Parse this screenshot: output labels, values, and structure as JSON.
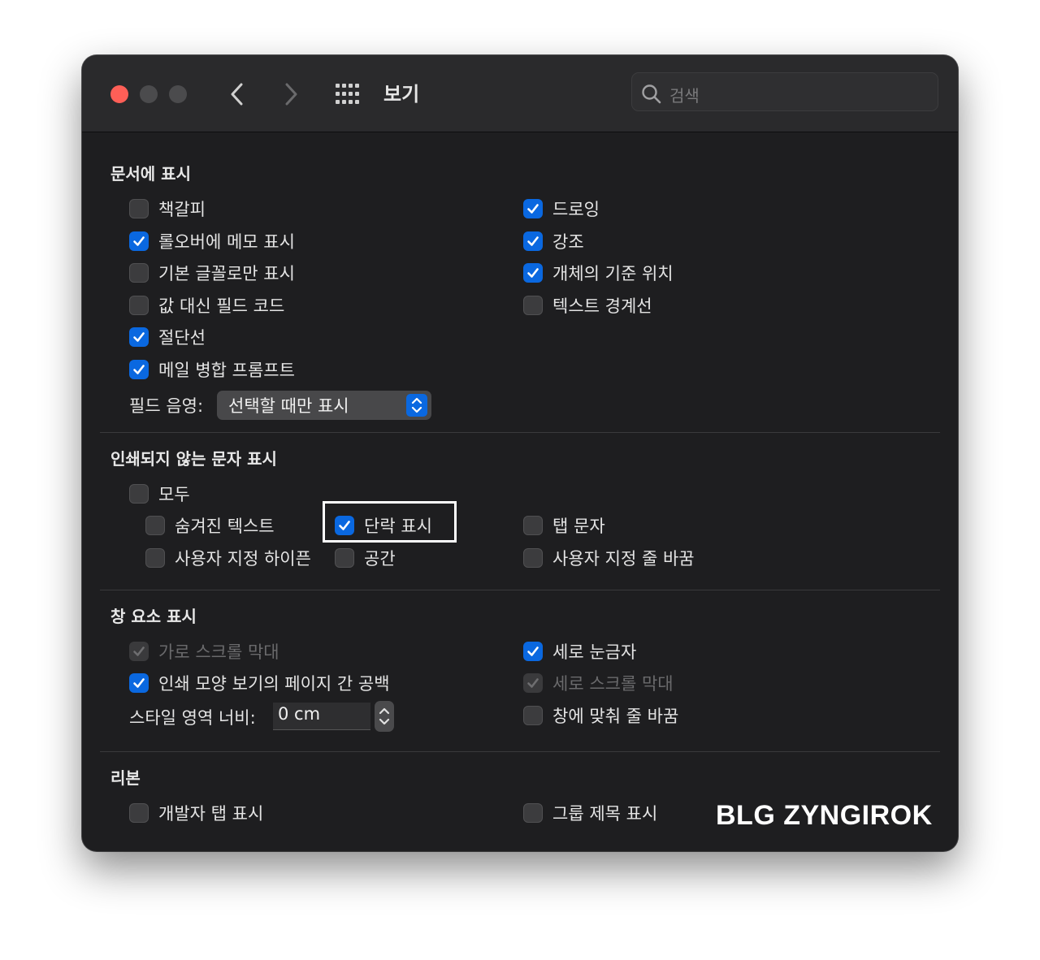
{
  "window": {
    "title": "보기",
    "search": {
      "placeholder": "검색"
    }
  },
  "sections": {
    "show_in_document": {
      "title": "문서에 표시",
      "items": [
        {
          "label": "책갈피",
          "checked": false
        },
        {
          "label": "롤오버에 메모 표시",
          "checked": true
        },
        {
          "label": "기본 글꼴로만 표시",
          "checked": false
        },
        {
          "label": "값 대신 필드 코드",
          "checked": false
        },
        {
          "label": "절단선",
          "checked": true
        },
        {
          "label": "메일 병합 프롬프트",
          "checked": true
        },
        {
          "label": "드로잉",
          "checked": true
        },
        {
          "label": "강조",
          "checked": true
        },
        {
          "label": "개체의 기준 위치",
          "checked": true
        },
        {
          "label": "텍스트 경계선",
          "checked": false
        }
      ],
      "field_shading": {
        "label": "필드 음영:",
        "value": "선택할 때만 표시"
      }
    },
    "nonprinting": {
      "title": "인쇄되지 않는 문자 표시",
      "items": [
        {
          "label": "모두",
          "checked": false
        },
        {
          "label": "숨겨진 텍스트",
          "checked": false
        },
        {
          "label": "단락 표시",
          "checked": true
        },
        {
          "label": "탭 문자",
          "checked": false
        },
        {
          "label": "사용자 지정 하이픈",
          "checked": false
        },
        {
          "label": "공간",
          "checked": false
        },
        {
          "label": "사용자 지정 줄 바꿈",
          "checked": false
        }
      ]
    },
    "window_elements": {
      "title": "창 요소 표시",
      "items": [
        {
          "label": "가로 스크롤 막대",
          "checked": true,
          "disabled": true
        },
        {
          "label": "인쇄 모양 보기의 페이지 간 공백",
          "checked": true
        },
        {
          "label": "세로 눈금자",
          "checked": true
        },
        {
          "label": "세로 스크롤 막대",
          "checked": true,
          "disabled": true
        },
        {
          "label": "창에 맞춰 줄 바꿈",
          "checked": false
        }
      ],
      "style_area": {
        "label": "스타일 영역 너비:",
        "value": "0 cm"
      }
    },
    "ribbon": {
      "title": "리본",
      "items": [
        {
          "label": "개발자 탭 표시",
          "checked": false
        },
        {
          "label": "그룹 제목 표시",
          "checked": false
        }
      ]
    }
  },
  "watermark": "BLG ZYNGIROK",
  "colors": {
    "accent": "#0a68e0",
    "window_bg": "#1e1e20",
    "titlebar_bg": "#2a2a2c"
  }
}
